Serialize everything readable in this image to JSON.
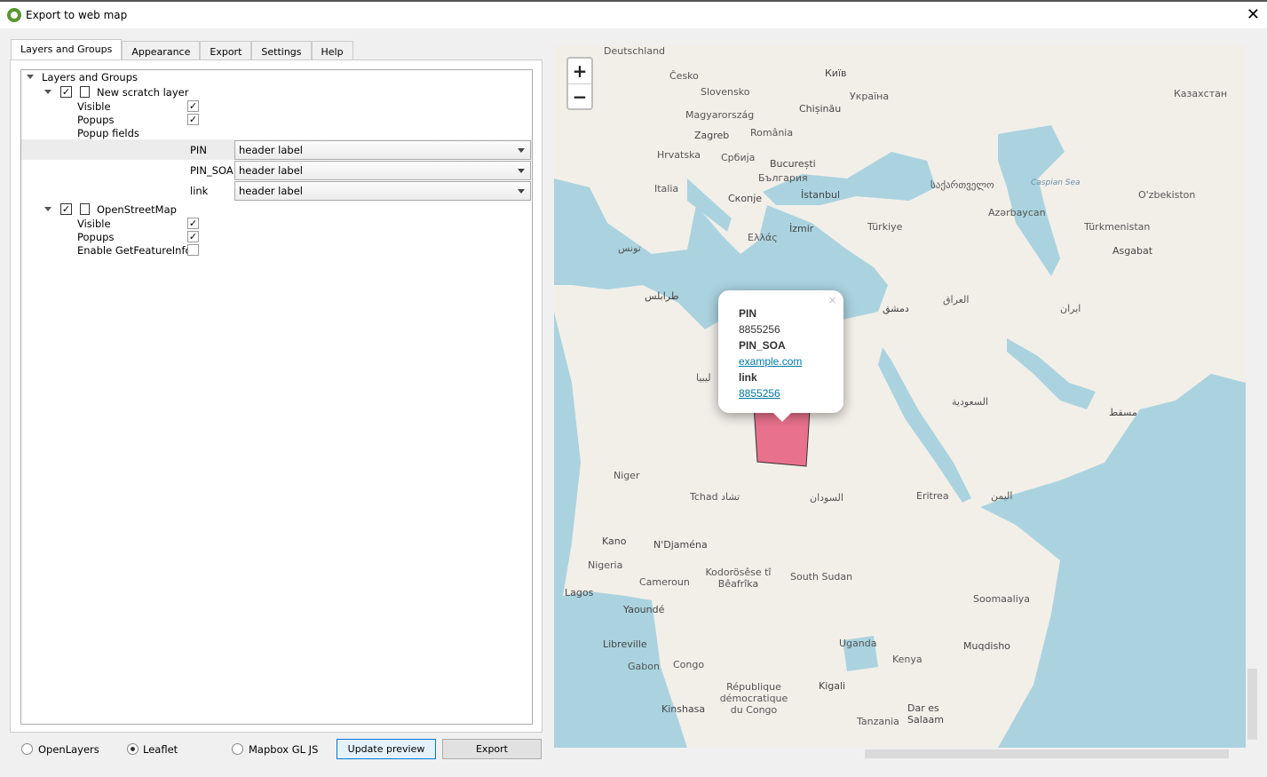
{
  "window": {
    "title": "Export to web map",
    "close_icon": "close-icon"
  },
  "tabs": [
    {
      "label": "Layers and Groups",
      "active": true
    },
    {
      "label": "Appearance"
    },
    {
      "label": "Export"
    },
    {
      "label": "Settings"
    },
    {
      "label": "Help"
    }
  ],
  "tree": {
    "root": "Layers and Groups",
    "layers": [
      {
        "name": "New scratch layer",
        "checked": true,
        "visible_label": "Visible",
        "visible": true,
        "popups_label": "Popups",
        "popups": true,
        "popup_fields_label": "Popup fields",
        "fields": [
          {
            "name": "PIN",
            "value": "header label"
          },
          {
            "name": "PIN_SOA",
            "value": "header label"
          },
          {
            "name": "link",
            "value": "header label"
          }
        ]
      },
      {
        "name": "OpenStreetMap",
        "checked": true,
        "visible_label": "Visible",
        "visible": true,
        "popups_label": "Popups",
        "popups": true,
        "getfeatureinfo_label": "Enable GetFeatureInfo?",
        "getfeatureinfo": false
      }
    ]
  },
  "footer": {
    "engines": [
      {
        "label": "OpenLayers",
        "selected": false
      },
      {
        "label": "Leaflet",
        "selected": true
      },
      {
        "label": "Mapbox GL JS",
        "selected": false
      }
    ],
    "update_preview": "Update preview",
    "export": "Export"
  },
  "map": {
    "zoom_in": "+",
    "zoom_out": "−",
    "colors": {
      "sea": "#aad3df",
      "land": "#f2efe9",
      "feature": "#e8718d"
    },
    "labels": [
      "Deutschland",
      "Česko",
      "Київ",
      "Slovensko",
      "Україна",
      "Magyarország",
      "Chișinău",
      "Казахстан",
      "Zagreb",
      "România",
      "Hrvatska",
      "Србија",
      "București",
      "България",
      "Italia",
      "Скопје",
      "İstanbul",
      "საქართველო",
      "Caspian Sea",
      "O'zbekiston",
      "Türkiye",
      "Azərbaycan",
      "Ελλάς",
      "İzmir",
      "Türkmenistan",
      "Asgabat",
      "تونس",
      "طرابلس",
      "ليبيا",
      "دمشق",
      "العراق",
      "ایران",
      "السعودية",
      "مسقط",
      "Niger",
      "Tchad تشاد",
      "السودان",
      "Eritrea",
      "اليمن",
      "Kano",
      "N'Djaména",
      "Nigeria",
      "Kodorösêse tî Bêafrîka",
      "South Sudan",
      "Cameroun",
      "Lagos",
      "Yaoundé",
      "Soomaaliya",
      "Libreville",
      "Gabon",
      "Congo",
      "Uganda",
      "Kenya",
      "Muqdisho",
      "République démocratique du Congo",
      "Kigali",
      "Kinshasa",
      "Tanzania",
      "Dar es Salaam"
    ],
    "popup": {
      "fields": [
        {
          "label": "PIN",
          "value": "8855256",
          "link": false
        },
        {
          "label": "PIN_SOA",
          "value": "example.com",
          "link": true
        },
        {
          "label": "link",
          "value": "8855256",
          "link": true
        }
      ],
      "close": "×"
    }
  }
}
